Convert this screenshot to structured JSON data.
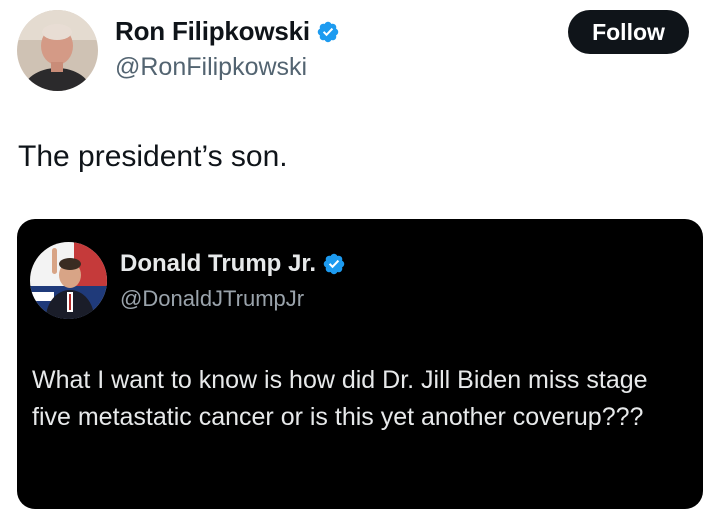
{
  "tweet": {
    "author": {
      "display_name": "Ron Filipkowski",
      "handle": "@RonFilipkowski",
      "verified": true,
      "avatar_icon": "profile-photo-avatar"
    },
    "follow_label": "Follow",
    "text": "The president’s son."
  },
  "quoted_tweet": {
    "author": {
      "display_name": "Donald Trump Jr.",
      "handle": "@DonaldJTrumpJr",
      "verified": true,
      "avatar_icon": "profile-photo-avatar"
    },
    "text": "What I want to know is how did Dr. Jill Biden miss stage five metastatic cancer or is this yet another coverup???"
  },
  "colors": {
    "verified_badge": "#1d9bf0",
    "follow_button_bg": "#0f1419",
    "quote_card_bg": "#000000",
    "handle_gray": "#536471"
  }
}
